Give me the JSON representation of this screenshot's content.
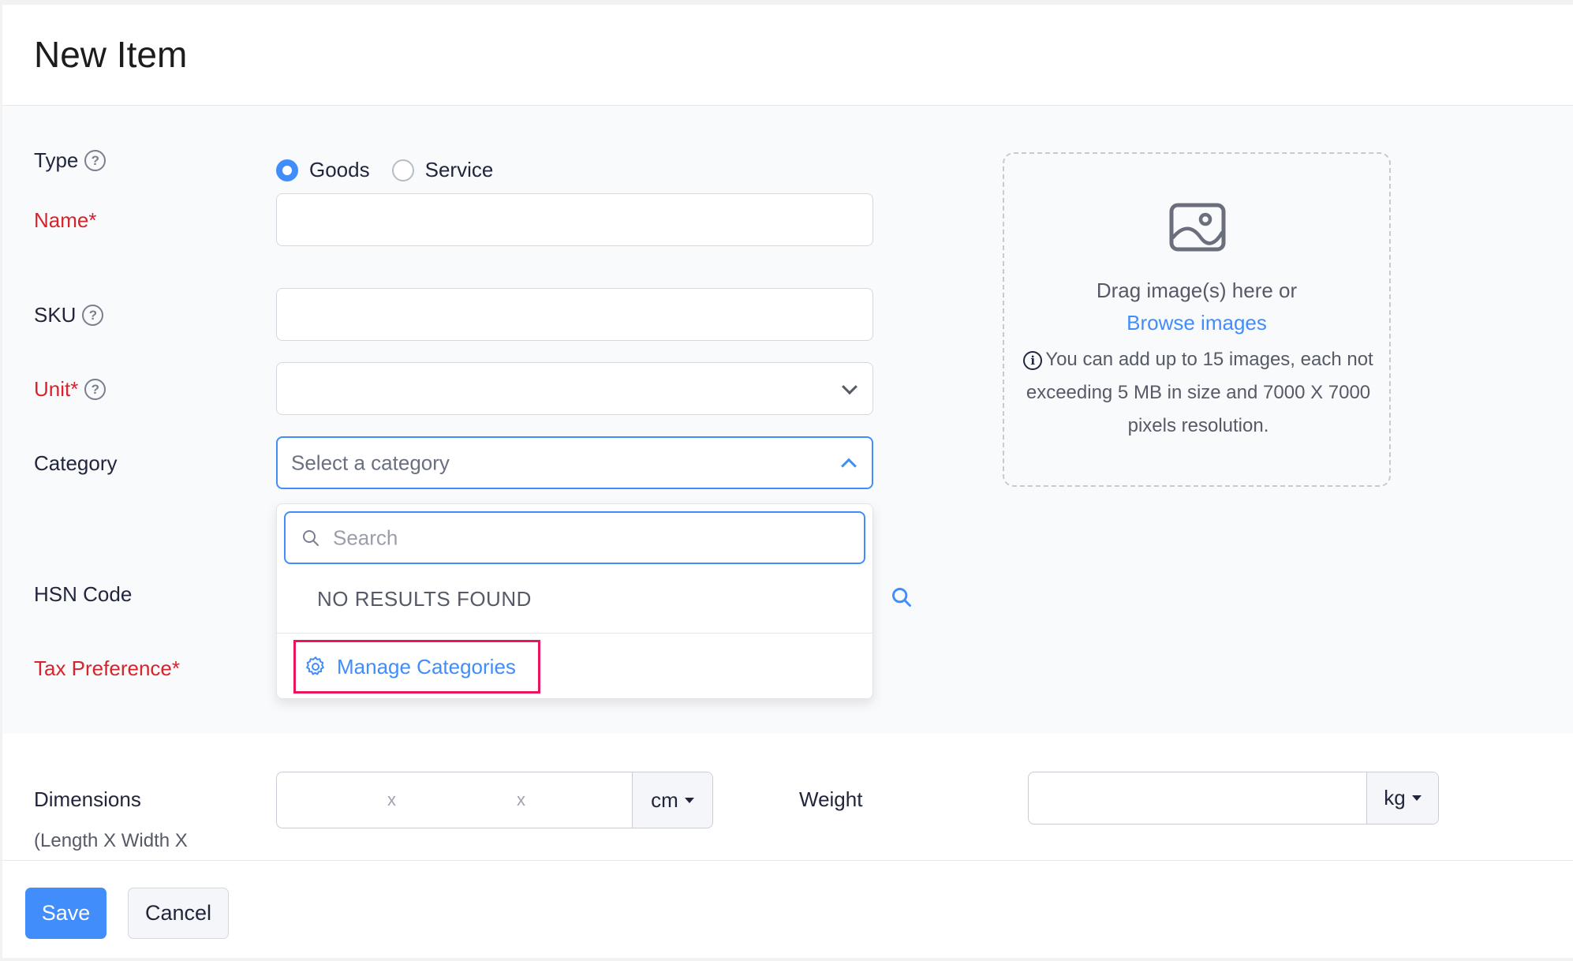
{
  "header": {
    "title": "New Item"
  },
  "form": {
    "type": {
      "label": "Type",
      "options": [
        {
          "label": "Goods",
          "checked": true
        },
        {
          "label": "Service",
          "checked": false
        }
      ]
    },
    "name": {
      "label": "Name*",
      "value": ""
    },
    "sku": {
      "label": "SKU",
      "value": ""
    },
    "unit": {
      "label": "Unit*",
      "value": ""
    },
    "category": {
      "label": "Category",
      "placeholder": "Select a category",
      "dropdown": {
        "search_placeholder": "Search",
        "empty_text": "NO RESULTS FOUND",
        "manage_label": "Manage Categories"
      }
    },
    "hsn": {
      "label": "HSN Code"
    },
    "tax": {
      "label": "Tax Preference*"
    },
    "dimensions": {
      "label": "Dimensions",
      "sublabel": "(Length X Width X",
      "separator": "x",
      "unit": "cm"
    },
    "weight": {
      "label": "Weight",
      "unit": "kg",
      "value": ""
    }
  },
  "image_upload": {
    "drag_text": "Drag image(s) here or",
    "browse_label": "Browse images",
    "info_text": "You can add up to 15 images, each not exceeding 5 MB in size and 7000 X 7000 pixels resolution."
  },
  "footer": {
    "save_label": "Save",
    "cancel_label": "Cancel"
  },
  "colors": {
    "accent": "#408dfb",
    "required": "#d6242c",
    "highlight": "#e8175d"
  }
}
